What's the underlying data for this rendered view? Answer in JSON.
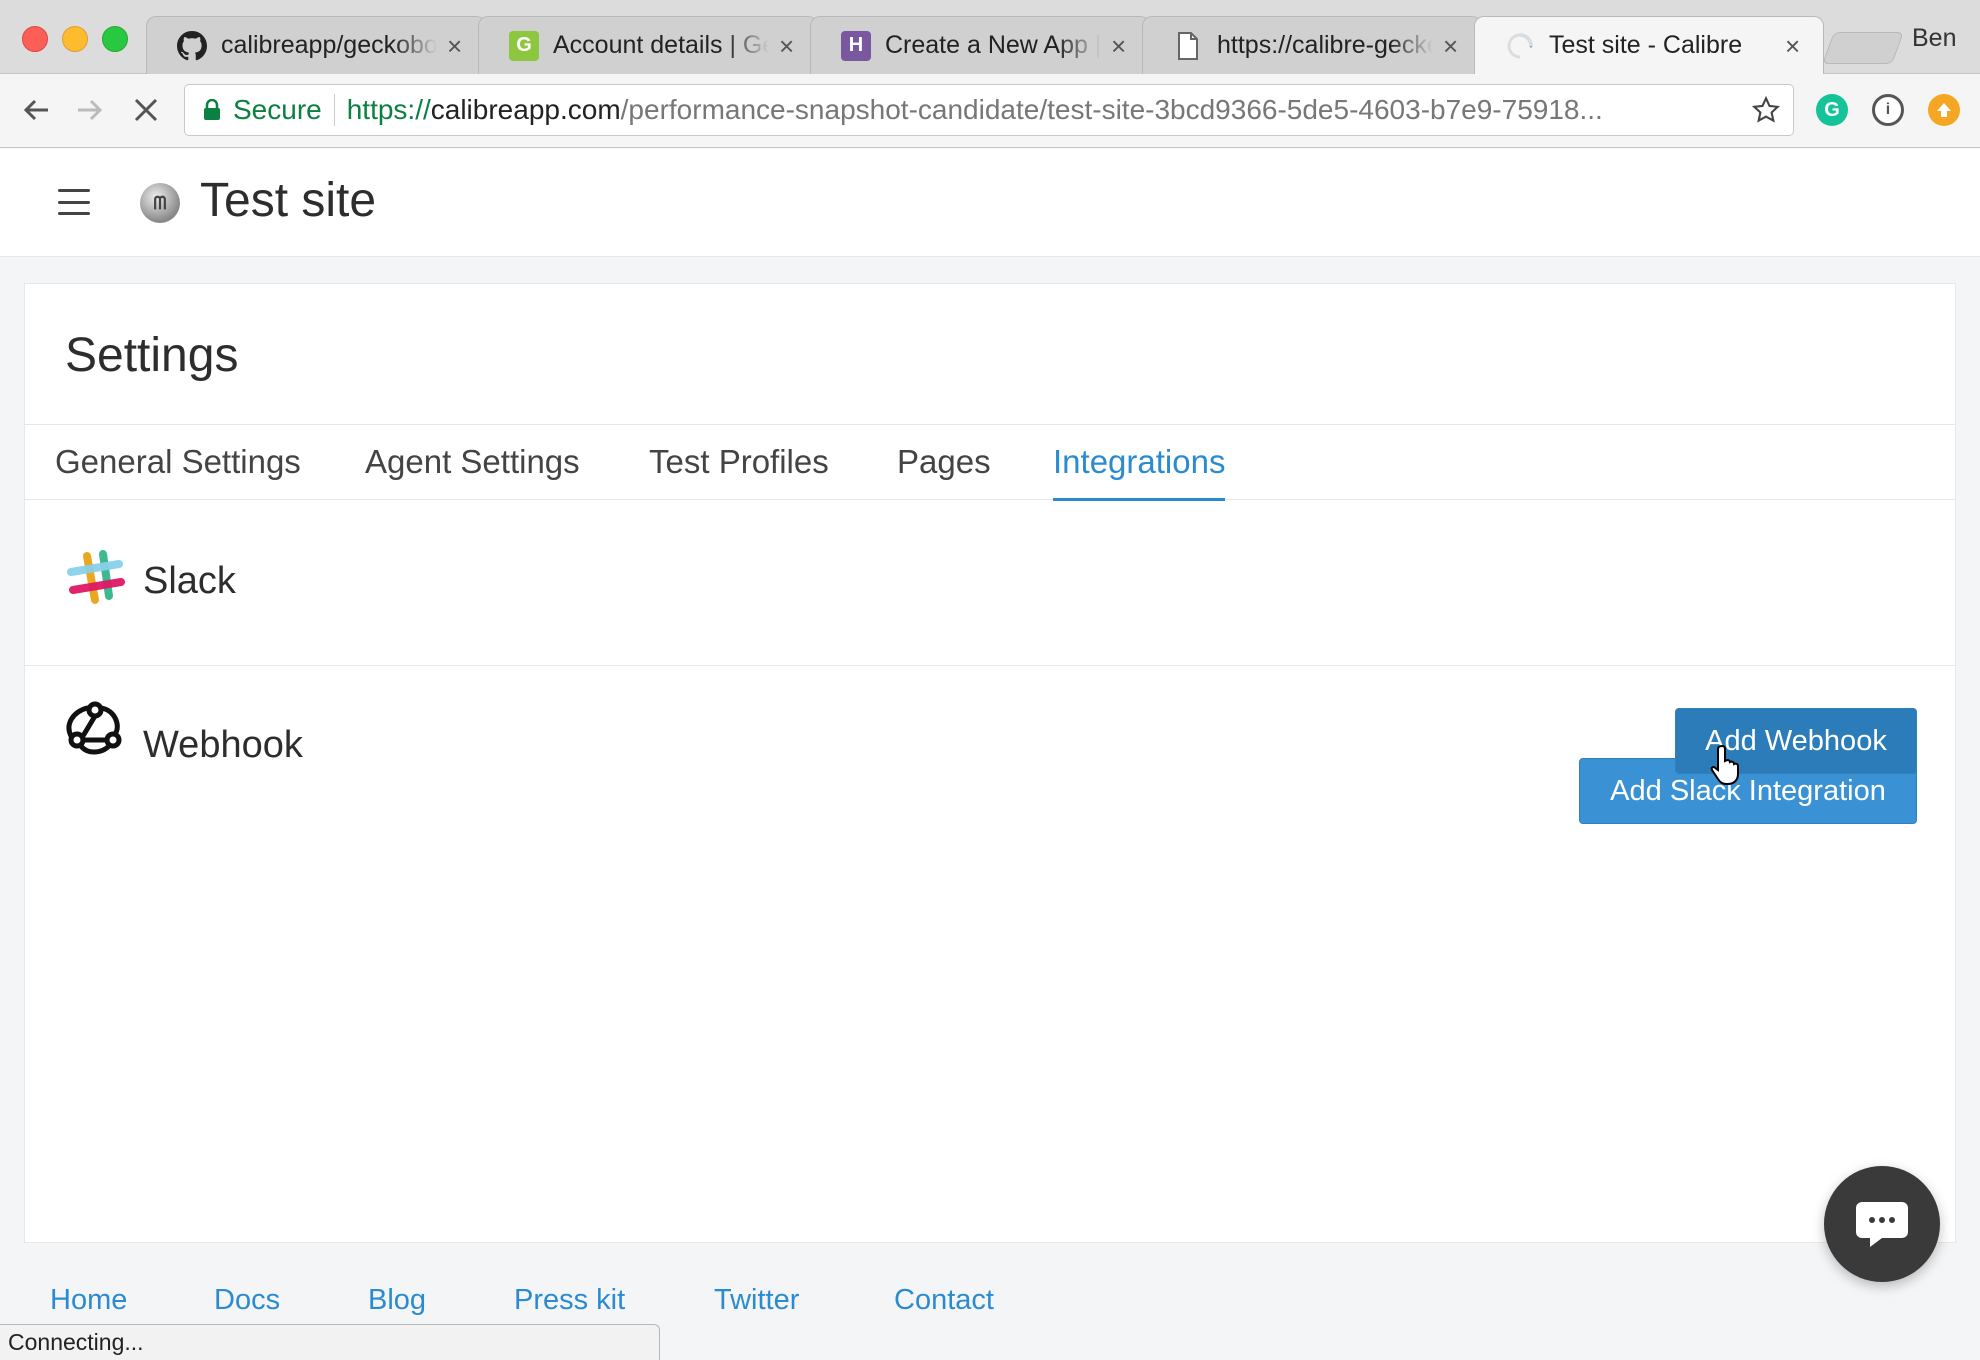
{
  "browser": {
    "tabs": [
      {
        "title": "calibreapp/geckoboard",
        "icon": "github-icon"
      },
      {
        "title": "Account details | Geckoboard",
        "icon": "geckoboard-icon"
      },
      {
        "title": "Create a New App | Heroku",
        "icon": "heroku-icon"
      },
      {
        "title": "https://calibre-geckoboard",
        "icon": "document-icon"
      },
      {
        "title": "Test site - Calibre",
        "icon": "loading-spinner-icon"
      }
    ],
    "profile_name": "Ben",
    "address": {
      "secure_label": "Secure",
      "scheme": "https://",
      "host": "calibreapp.com",
      "path": "/performance-snapshot-candidate/test-site-3bcd9366-5de5-4603-b7e9-75918..."
    },
    "status_text": "Connecting..."
  },
  "header": {
    "site_title": "Test site",
    "logo_text": "ᗰ"
  },
  "settings": {
    "title": "Settings",
    "tabs": [
      {
        "label": "General Settings",
        "active": false
      },
      {
        "label": "Agent Settings",
        "active": false
      },
      {
        "label": "Test Profiles",
        "active": false
      },
      {
        "label": "Pages",
        "active": false
      },
      {
        "label": "Integrations",
        "active": true
      }
    ],
    "integrations": [
      {
        "name": "Slack",
        "icon": "slack-icon",
        "button_label": "Add Slack Integration"
      },
      {
        "name": "Webhook",
        "icon": "webhook-icon",
        "button_label": "Add Webhook"
      }
    ]
  },
  "footer": {
    "links": [
      "Home",
      "Docs",
      "Blog",
      "Press kit",
      "Twitter",
      "Contact"
    ]
  },
  "colors": {
    "accent": "#3a92d4",
    "link": "#2b8bd0",
    "secure_green": "#0b8043"
  }
}
